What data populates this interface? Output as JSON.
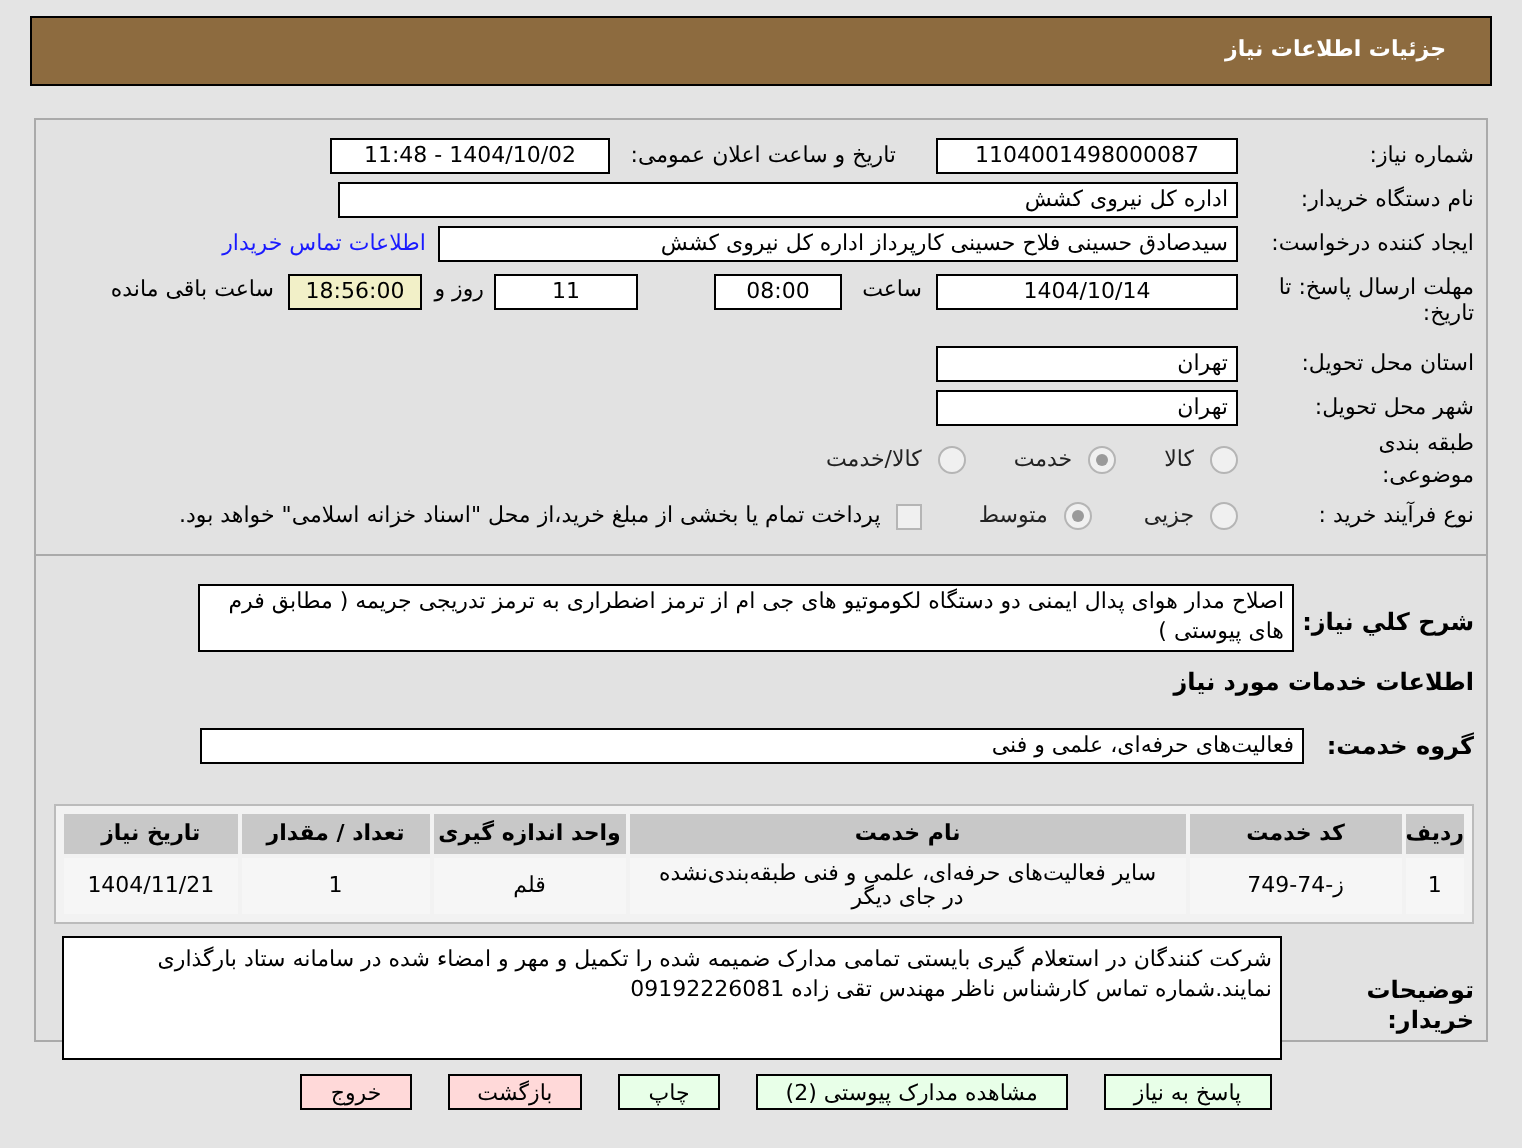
{
  "header": {
    "title": "جزئیات اطلاعات نیاز"
  },
  "need_number": {
    "label": "شماره نیاز:",
    "value": "1104001498000087"
  },
  "announce": {
    "label": "تاریخ و ساعت اعلان عمومی:",
    "value": "1404/10/02 - 11:48"
  },
  "buyer": {
    "label": "نام دستگاه خریدار:",
    "value": "اداره کل نیروی کشش"
  },
  "requester": {
    "label": "ایجاد کننده درخواست:",
    "value": "سیدصادق حسینی فلاح حسینی کارپرداز اداره کل نیروی کشش",
    "link": "اطلاعات تماس خریدار"
  },
  "deadline": {
    "label": "مهلت ارسال پاسخ: تا تاریخ:",
    "date": "1404/10/14",
    "time_label": "ساعت",
    "time": "08:00",
    "days": "11",
    "days_label": "روز و",
    "remaining": "18:56:00",
    "remaining_label": "ساعت باقی مانده"
  },
  "province": {
    "label": "استان محل تحویل:",
    "value": "تهران"
  },
  "city": {
    "label": "شهر محل تحویل:",
    "value": "تهران"
  },
  "category": {
    "label": "طبقه بندی موضوعی:",
    "options": [
      {
        "label": "کالا",
        "selected": false
      },
      {
        "label": "خدمت",
        "selected": true
      },
      {
        "label": "کالا/خدمت",
        "selected": false
      }
    ]
  },
  "purchase_type": {
    "label": "نوع فرآیند خرید :",
    "options": [
      {
        "label": "جزیی",
        "selected": false
      },
      {
        "label": "متوسط",
        "selected": true
      }
    ],
    "payment": {
      "checked": false,
      "text": "پرداخت تمام یا بخشی از مبلغ خرید،از محل \"اسناد خزانه اسلامی\" خواهد بود."
    }
  },
  "description": {
    "label": "شرح کلي نياز:",
    "value": "اصلاح مدار هوای پدال ایمنی دو دستگاه لکوموتیو های جی ام از ترمز اضطراری به ترمز تدریجی جریمه ( مطابق فرم های پیوستی )"
  },
  "services_heading": "اطلاعات خدمات مورد نیاز",
  "service_group": {
    "label": "گروه خدمت:",
    "value": "فعالیت‌های حرفه‌ای، علمی و فنی"
  },
  "table": {
    "columns": [
      "ردیف",
      "کد خدمت",
      "نام خدمت",
      "واحد اندازه گیری",
      "تعداد / مقدار",
      "تاریخ نیاز"
    ],
    "rows": [
      [
        "1",
        "ز-74-749",
        "سایر فعالیت‌های حرفه‌ای، علمی و فنی طبقه‌بندی‌نشده در جای دیگر",
        "قلم",
        "1",
        "1404/11/21"
      ]
    ]
  },
  "buyer_notes": {
    "label": "توضیحات خریدار:",
    "value": "شرکت کنندگان در استعلام گیری بایستی تمامی مدارک ضمیمه شده را تکمیل و مهر و امضاء شده در سامانه ستاد بارگذاری نمایند.شماره تماس کارشناس ناظر مهندس تقی زاده 09192226081"
  },
  "buttons": [
    {
      "label": "پاسخ به نیاز",
      "kind": "primary"
    },
    {
      "label": "مشاهده مدارک پیوستی (2)",
      "kind": "primary"
    },
    {
      "label": "چاپ",
      "kind": "primary"
    },
    {
      "label": "بازگشت",
      "kind": "danger"
    },
    {
      "label": "خروج",
      "kind": "danger"
    }
  ]
}
